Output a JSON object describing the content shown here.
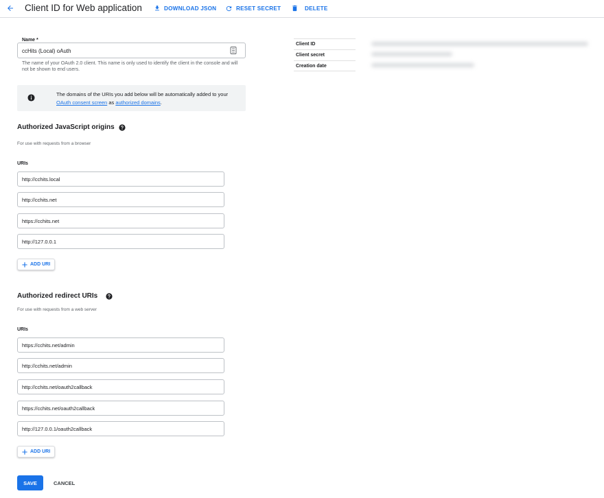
{
  "header": {
    "title": "Client ID for Web application",
    "actions": {
      "download_json": "DOWNLOAD JSON",
      "reset_secret": "RESET SECRET",
      "delete": "DELETE"
    }
  },
  "name_field": {
    "label": "Name *",
    "value": "ccHits (Local) oAuth",
    "helper": "The name of your OAuth 2.0 client. This name is only used to identify the client in the console and will not be shown to end users."
  },
  "info": {
    "text_before": "The domains of the URIs you add below will be automatically added to your",
    "link_consent": "OAuth consent screen",
    "text_middle": "as",
    "link_domains": "authorized domains",
    "text_end": "."
  },
  "js_origins": {
    "title": "Authorized JavaScript origins",
    "subtitle": "For use with requests from a browser",
    "uris_label": "URIs",
    "uris": [
      "http://cchits.local",
      "http://cchits.net",
      "https://cchits.net",
      "http://127.0.0.1"
    ],
    "add_label": "ADD URI"
  },
  "redirect_uris": {
    "title": "Authorized redirect URIs",
    "subtitle": "For use with requests from a web server",
    "uris_label": "URIs",
    "uris": [
      "https://cchits.net/admin",
      "http://cchits.net/admin",
      "http://cchits.net/oauth2callback",
      "https://cchits.net/oauth2callback",
      "http://127.0.0.1/oauth2callback"
    ],
    "add_label": "ADD URI"
  },
  "buttons": {
    "save": "SAVE",
    "cancel": "CANCEL"
  },
  "details": {
    "client_id": "Client ID",
    "client_secret": "Client secret",
    "creation_date": "Creation date"
  },
  "colors": {
    "accent": "#1a73e8",
    "text": "#202124",
    "muted": "#5f6368",
    "info_bg": "#f1f3f4"
  },
  "icons": {
    "back": "arrow-back-icon",
    "download": "download-icon",
    "reset": "refresh-icon",
    "delete": "trash-icon",
    "info": "info-icon",
    "help": "help-icon",
    "add": "plus-icon",
    "field": "text-field-icon"
  }
}
